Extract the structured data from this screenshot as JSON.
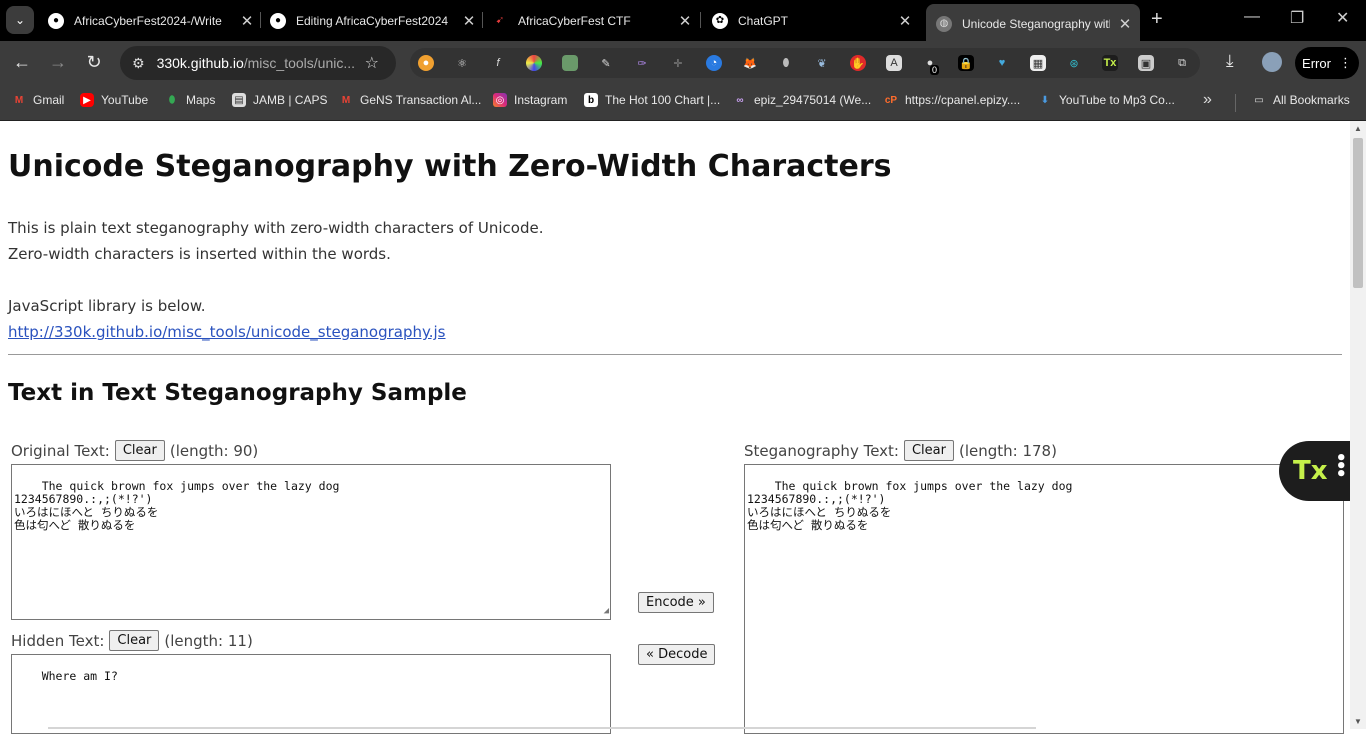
{
  "tabs": [
    {
      "title": "AfricaCyberFest2024-/Write",
      "icon": "github-icon",
      "active": false
    },
    {
      "title": "Editing AfricaCyberFest2024",
      "icon": "github-icon",
      "active": false
    },
    {
      "title": "AfricaCyberFest CTF",
      "icon": "ctf-icon",
      "active": false
    },
    {
      "title": "ChatGPT",
      "icon": "chatgpt-icon",
      "active": false
    },
    {
      "title": "Unicode Steganography with",
      "icon": "globe-icon",
      "active": true
    }
  ],
  "address": {
    "host": "330k.github.io",
    "path": "/misc_tools/unic..."
  },
  "toolbar": {
    "error_label": "Error",
    "ext_badge": "0",
    "tx_label": "Tx"
  },
  "bookmarks": [
    {
      "label": "Gmail",
      "icon": "gmail-icon"
    },
    {
      "label": "YouTube",
      "icon": "youtube-icon"
    },
    {
      "label": "Maps",
      "icon": "maps-icon"
    },
    {
      "label": "JAMB | CAPS",
      "icon": "jamb-icon"
    },
    {
      "label": "GeNS Transaction Al...",
      "icon": "gmail-icon"
    },
    {
      "label": "Instagram",
      "icon": "instagram-icon"
    },
    {
      "label": "The Hot 100 Chart |...",
      "icon": "billboard-icon"
    },
    {
      "label": "epiz_29475014 (We...",
      "icon": "infinity-icon"
    },
    {
      "label": "https://cpanel.epizy....",
      "icon": "cpanel-icon"
    },
    {
      "label": "YouTube to Mp3 Co...",
      "icon": "download-icon"
    }
  ],
  "all_bookmarks_label": "All Bookmarks",
  "page": {
    "title": "Unicode Steganography with Zero-Width Characters",
    "intro_line1": "This is plain text steganography with zero-width characters of Unicode.",
    "intro_line2": "Zero-width characters is inserted within the words.",
    "lib_text": "JavaScript library is below.",
    "lib_link": "http://330k.github.io/misc_tools/unicode_steganography.js",
    "section_title": "Text in Text Steganography Sample",
    "original_label": "Original Text:",
    "original_length": "(length: 90)",
    "original_value": "The quick brown fox jumps over the lazy dog\n1234567890.:,;(*!?')\nいろはにほへと ちりぬるを\n色は匂へど 散りぬるを",
    "hidden_label": "Hidden Text:",
    "hidden_length": "(length: 11)",
    "hidden_value": "Where am I?",
    "stego_label": "Steganography Text:",
    "stego_length": "(length: 178)",
    "stego_value": "The quick brown fox jumps over the lazy dog\n1234567890.:,;(*!?')\nいろはにほへと ちりぬるを\n色は匂へど 散りぬるを",
    "clear_label": "Clear",
    "encode_label": "Encode »",
    "decode_label": "« Decode"
  }
}
